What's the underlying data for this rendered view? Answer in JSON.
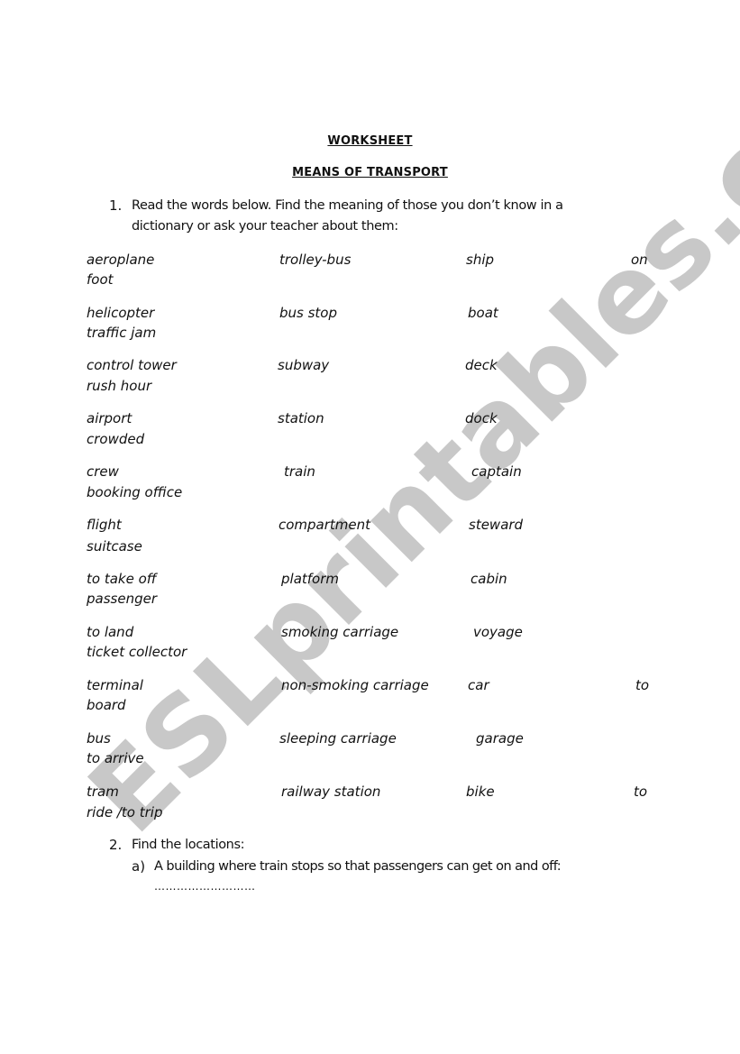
{
  "header": {
    "title": "WORKSHEET",
    "subtitle": "MEANS OF TRANSPORT"
  },
  "question1": {
    "number": "1.",
    "line1": "Read the words below. Find the meaning of those you don’t know in a",
    "line2": "dictionary or ask your teacher about them:"
  },
  "vocabulary": {
    "rows": [
      {
        "c1": "aeroplane",
        "c2": "trolley-bus",
        "c3": "ship",
        "c4": "on",
        "wrap": "foot"
      },
      {
        "c1": "helicopter",
        "c2": "bus stop",
        "c3": "boat",
        "c4": "",
        "wrap": "traffic jam"
      },
      {
        "c1": "control tower",
        "c2": "subway",
        "c3": "deck",
        "c4": "",
        "wrap": "rush hour"
      },
      {
        "c1": "airport",
        "c2": "station",
        "c3": "dock",
        "c4": "",
        "wrap": "crowded"
      },
      {
        "c1": "crew",
        "c2": "train",
        "c3": "captain",
        "c4": "",
        "wrap": "booking office"
      },
      {
        "c1": "flight",
        "c2": "compartment",
        "c3": "steward",
        "c4": "",
        "wrap": "suitcase"
      },
      {
        "c1": "to take off",
        "c2": "platform",
        "c3": "cabin",
        "c4": "",
        "wrap": "passenger"
      },
      {
        "c1": "to land",
        "c2": "smoking carriage",
        "c3": "voyage",
        "c4": "",
        "wrap": "ticket collector"
      },
      {
        "c1": "terminal",
        "c2": "non-smoking carriage",
        "c3": "car",
        "c4": "to",
        "wrap": "board"
      },
      {
        "c1": "bus",
        "c2": "sleeping carriage",
        "c3": "garage",
        "c4": "",
        "wrap": "to arrive"
      },
      {
        "c1": "tram",
        "c2": "railway station",
        "c3": "bike",
        "c4": "to",
        "wrap": "ride /to trip"
      }
    ]
  },
  "question2": {
    "number": "2.",
    "text": "Find the locations:",
    "items": [
      {
        "label": "a)",
        "text": "A building where train stops so that passengers can get on and off:",
        "answer_blank": "………………………"
      }
    ]
  },
  "watermark": {
    "text": "ESLprintables.com",
    "color": "#c8c8c8"
  }
}
